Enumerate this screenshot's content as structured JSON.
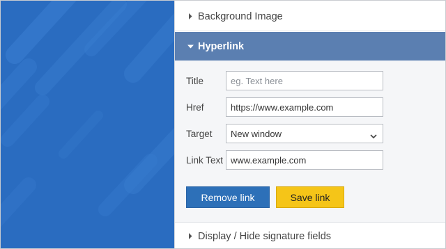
{
  "sections": {
    "background_image": {
      "label": "Background Image",
      "state": "collapsed"
    },
    "hyperlink": {
      "label": "Hyperlink",
      "state": "expanded"
    },
    "display_hide": {
      "label": "Display / Hide signature fields",
      "state": "collapsed"
    }
  },
  "hyperlink_form": {
    "title": {
      "label": "Title",
      "value": "",
      "placeholder": "eg. Text here"
    },
    "href": {
      "label": "Href",
      "value": "https://www.example.com"
    },
    "target": {
      "label": "Target",
      "value": "New window"
    },
    "link_text": {
      "label": "Link Text",
      "value": "www.example.com"
    }
  },
  "buttons": {
    "remove": "Remove link",
    "save": "Save link"
  },
  "colors": {
    "left_panel": "#2a6cc0",
    "section_active": "#5b7fb1",
    "remove_button": "#2d70b8",
    "save_button": "#f5c518"
  },
  "icons": {
    "collapsed": "caret-right-icon",
    "expanded": "caret-down-icon",
    "select": "chevron-down-icon"
  }
}
